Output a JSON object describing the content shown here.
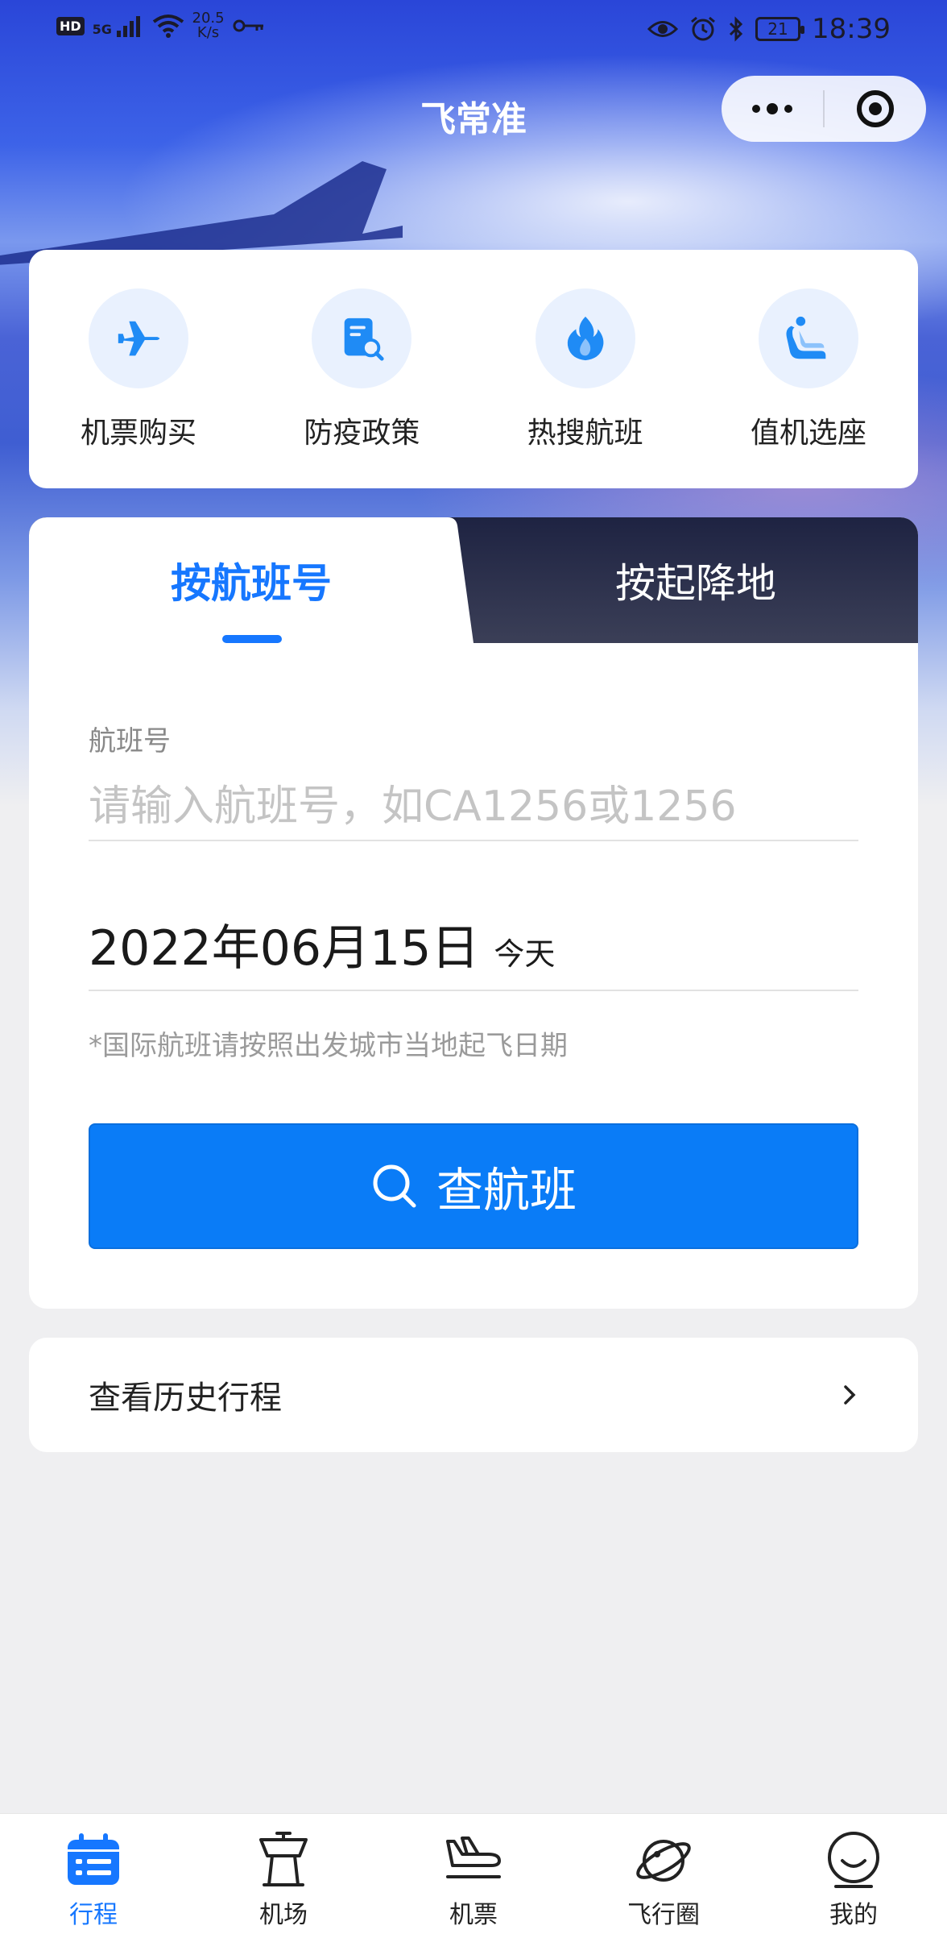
{
  "status_bar": {
    "hd": "HD",
    "signal": "5G",
    "net_speed_value": "20.5",
    "net_speed_unit": "K/s",
    "battery": "21",
    "time": "18:39"
  },
  "header": {
    "title": "飞常准",
    "more_icon": "more-dots-icon",
    "close_icon": "target-circle-icon"
  },
  "quick_services": [
    {
      "label": "机票购买",
      "icon": "airplane-icon"
    },
    {
      "label": "防疫政策",
      "icon": "document-search-icon"
    },
    {
      "label": "热搜航班",
      "icon": "flame-icon"
    },
    {
      "label": "值机选座",
      "icon": "seat-icon"
    }
  ],
  "search": {
    "tabs": [
      {
        "label": "按航班号",
        "active": true
      },
      {
        "label": "按起降地",
        "active": false
      }
    ],
    "flight_label": "航班号",
    "flight_placeholder": "请输入航班号，如CA1256或1256",
    "flight_value": "",
    "date": "2022年06月15日",
    "date_tag": "今天",
    "note": "*国际航班请按照出发城市当地起飞日期",
    "button_label": "查航班"
  },
  "history": {
    "label": "查看历史行程"
  },
  "tabbar": [
    {
      "label": "行程",
      "icon": "calendar-list-icon",
      "active": true
    },
    {
      "label": "机场",
      "icon": "control-tower-icon",
      "active": false
    },
    {
      "label": "机票",
      "icon": "plane-landing-icon",
      "active": false
    },
    {
      "label": "飞行圈",
      "icon": "planet-icon",
      "active": false
    },
    {
      "label": "我的",
      "icon": "smile-face-icon",
      "active": false
    }
  ],
  "colors": {
    "accent": "#1677ff",
    "button": "#0a7cf7",
    "dark_tab": "#2a2e48"
  }
}
